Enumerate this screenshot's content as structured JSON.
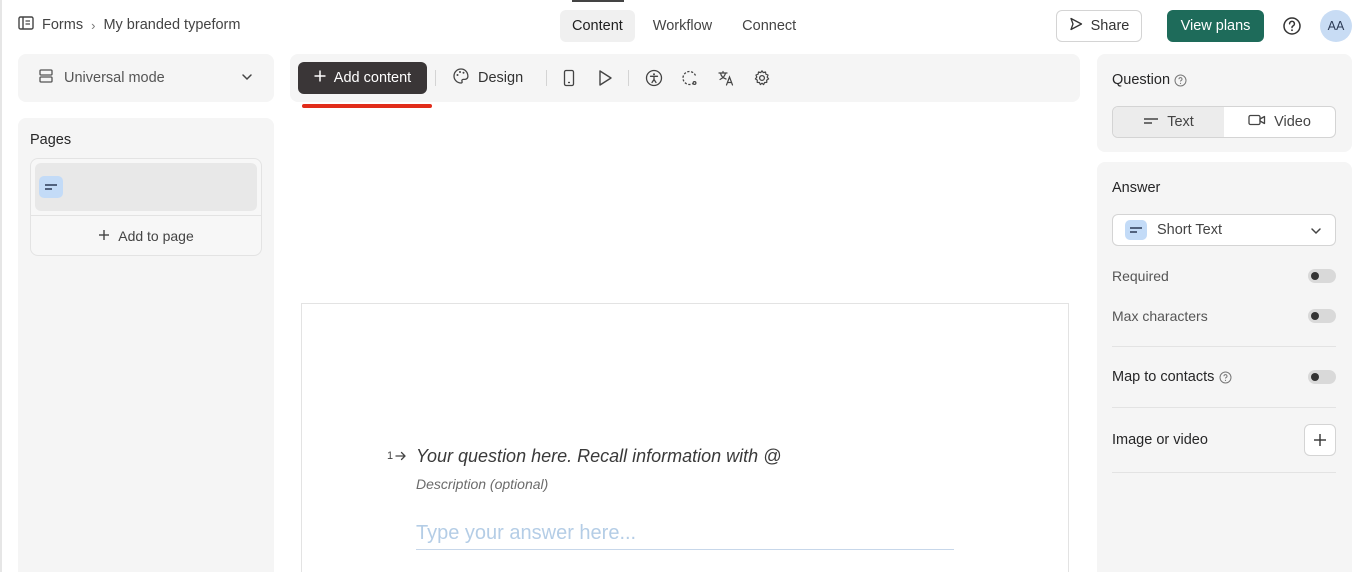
{
  "breadcrumb": {
    "root": "Forms",
    "current": "My branded typeform"
  },
  "nav": {
    "tabs": [
      "Content",
      "Workflow",
      "Connect"
    ],
    "active": "Content"
  },
  "header": {
    "share_label": "Share",
    "view_plans_label": "View plans",
    "avatar_initials": "AA"
  },
  "sidebar": {
    "mode_label": "Universal mode",
    "pages_title": "Pages",
    "add_to_page_label": "Add to page"
  },
  "toolbar": {
    "add_content_label": "Add content",
    "design_label": "Design"
  },
  "canvas": {
    "question_number": "1",
    "question_placeholder": "Your question here. Recall information with @",
    "description_placeholder": "Description (optional)",
    "answer_placeholder": "Type your answer here..."
  },
  "panel": {
    "question_label": "Question",
    "question_types": [
      "Text",
      "Video"
    ],
    "active_question_type": "Text",
    "answer_label": "Answer",
    "answer_type": "Short Text",
    "required_label": "Required",
    "required": false,
    "max_characters_label": "Max characters",
    "max_characters": false,
    "map_contacts_label": "Map to contacts",
    "map_contacts": false,
    "image_video_label": "Image or video"
  },
  "colors": {
    "primary_button": "#1e6b5a",
    "add_content_button": "#3a3637",
    "highlight_underline": "#e12c1a",
    "icon_badge": "#c3dbf7"
  }
}
